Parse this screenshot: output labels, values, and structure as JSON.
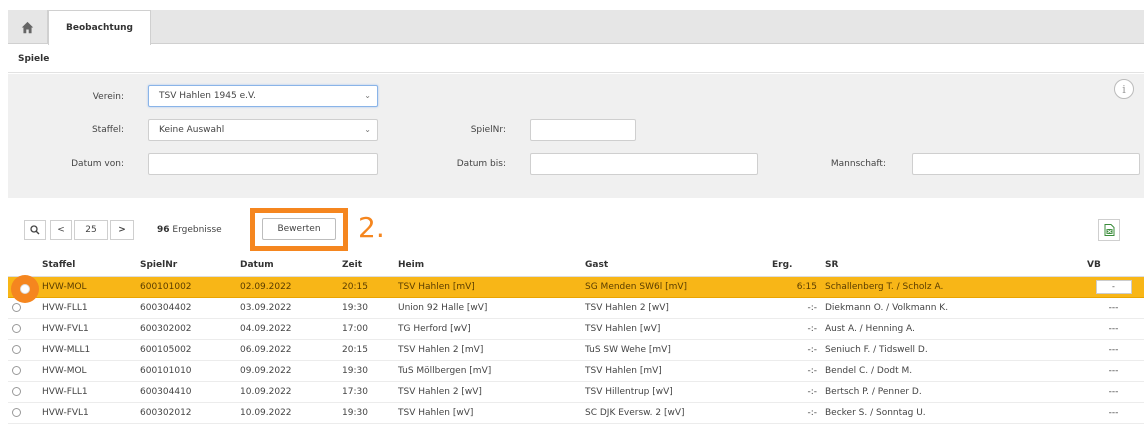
{
  "tabs": {
    "active_label": "Beobachtung"
  },
  "section": {
    "title": "Spiele"
  },
  "filters": {
    "verein_label": "Verein:",
    "verein_value": "TSV Hahlen 1945 e.V.",
    "staffel_label": "Staffel:",
    "staffel_value": "Keine Auswahl",
    "spielnr_label": "SpielNr:",
    "spielnr_value": "",
    "datum_von_label": "Datum von:",
    "datum_von_value": "",
    "datum_bis_label": "Datum bis:",
    "datum_bis_value": "",
    "mannschaft_label": "Mannschaft:",
    "mannschaft_value": ""
  },
  "toolbar": {
    "page_size": "25",
    "prev_label": "<",
    "next_label": ">",
    "results_count": "96",
    "results_label": "Ergebnisse",
    "bewerten_label": "Bewerten",
    "step_label": "2."
  },
  "table": {
    "headers": {
      "staffel": "Staffel",
      "spielnr": "SpielNr",
      "datum": "Datum",
      "zeit": "Zeit",
      "heim": "Heim",
      "gast": "Gast",
      "erg": "Erg.",
      "sr": "SR",
      "vb": "VB"
    },
    "rows": [
      {
        "staffel": "HVW-MOL",
        "spielnr": "600101002",
        "datum": "02.09.2022",
        "zeit": "20:15",
        "heim": "TSV Hahlen [mV]",
        "gast": "SG Menden SW6l [mV]",
        "erg": "6:15",
        "sr": "Schallenberg T. / Scholz A.",
        "vb": "-"
      },
      {
        "staffel": "HVW-FLL1",
        "spielnr": "600304402",
        "datum": "03.09.2022",
        "zeit": "19:30",
        "heim": "Union 92 Halle [wV]",
        "gast": "TSV Hahlen 2 [wV]",
        "erg": "-:-",
        "sr": "Diekmann O. / Volkmann K.",
        "vb": "---"
      },
      {
        "staffel": "HVW-FVL1",
        "spielnr": "600302002",
        "datum": "04.09.2022",
        "zeit": "17:00",
        "heim": "TG Herford [wV]",
        "gast": "TSV Hahlen [wV]",
        "erg": "-:-",
        "sr": "Aust A. / Henning A.",
        "vb": "---"
      },
      {
        "staffel": "HVW-MLL1",
        "spielnr": "600105002",
        "datum": "06.09.2022",
        "zeit": "20:15",
        "heim": "TSV Hahlen 2 [mV]",
        "gast": "TuS SW Wehe [mV]",
        "erg": "-:-",
        "sr": "Seniuch F. / Tidswell D.",
        "vb": "---"
      },
      {
        "staffel": "HVW-MOL",
        "spielnr": "600101010",
        "datum": "09.09.2022",
        "zeit": "19:30",
        "heim": "TuS Möllbergen [mV]",
        "gast": "TSV Hahlen [mV]",
        "erg": "-:-",
        "sr": "Bendel C. / Dodt M.",
        "vb": "---"
      },
      {
        "staffel": "HVW-FLL1",
        "spielnr": "600304410",
        "datum": "10.09.2022",
        "zeit": "17:30",
        "heim": "TSV Hahlen 2 [wV]",
        "gast": "TSV Hillentrup [wV]",
        "erg": "-:-",
        "sr": "Bertsch P. / Penner D.",
        "vb": "---"
      },
      {
        "staffel": "HVW-FVL1",
        "spielnr": "600302012",
        "datum": "10.09.2022",
        "zeit": "19:30",
        "heim": "TSV Hahlen [wV]",
        "gast": "SC DJK Eversw. 2 [wV]",
        "erg": "-:-",
        "sr": "Becker S. / Sonntag U.",
        "vb": "---"
      }
    ]
  },
  "colors": {
    "accent_orange": "#f5861f",
    "selected_row": "#f8b617"
  }
}
